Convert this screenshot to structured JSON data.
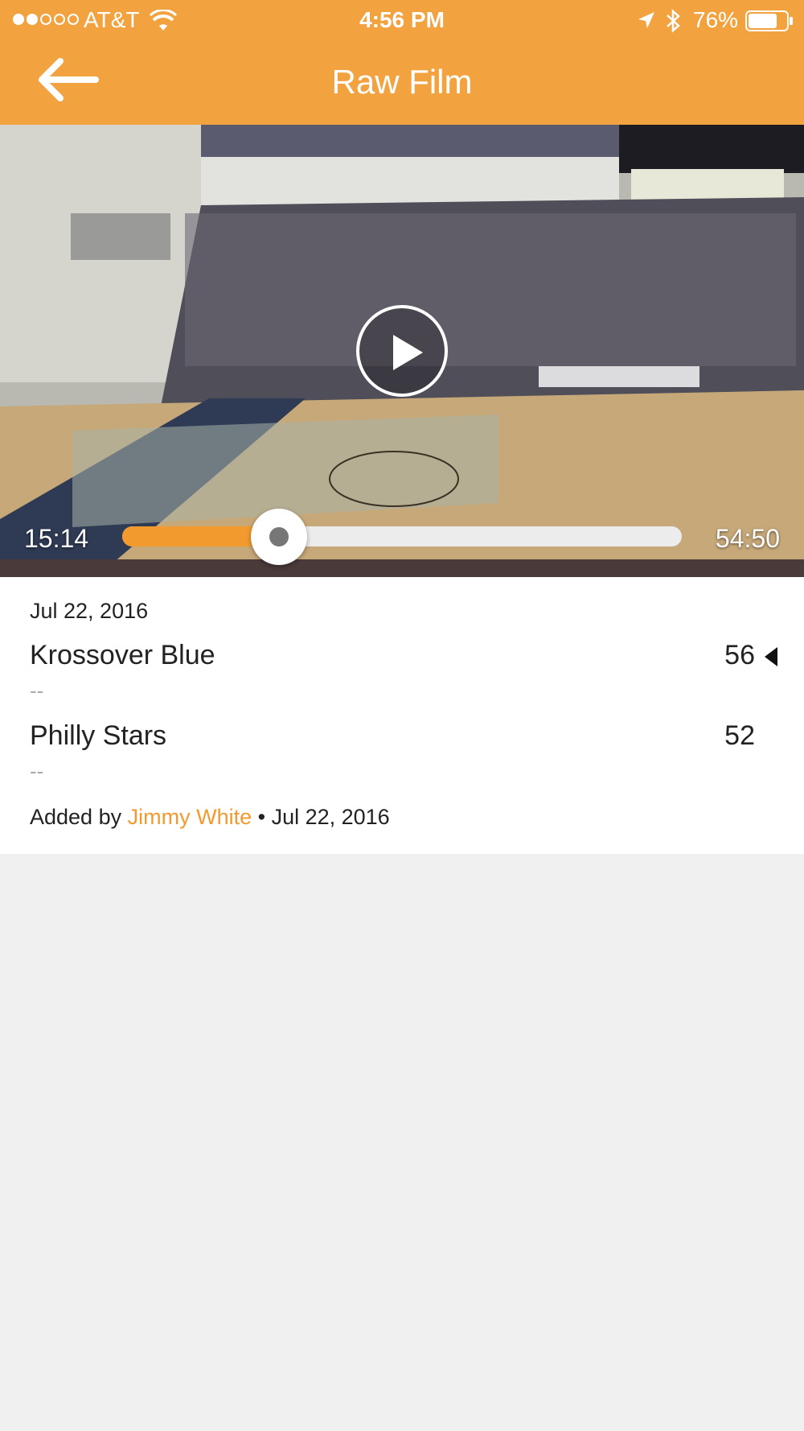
{
  "status_bar": {
    "carrier": "AT&T",
    "time": "4:56 PM",
    "battery": "76%",
    "signal_bars_filled": 2,
    "signal_bars_total": 5,
    "battery_level": 0.76
  },
  "nav": {
    "title": "Raw Film",
    "back_icon": "arrow-left-icon"
  },
  "video": {
    "elapsed": "15:14",
    "duration": "54:50",
    "progress": 0.28,
    "accent_color": "#f29a2e",
    "play_icon": "play-icon"
  },
  "game": {
    "date": "Jul 22, 2016",
    "teams": [
      {
        "name": "Krossover Blue",
        "score": "56",
        "record": "--",
        "winner": true
      },
      {
        "name": "Philly Stars",
        "score": "52",
        "record": "--",
        "winner": false
      }
    ],
    "added_prefix": "Added by",
    "added_by": "Jimmy White",
    "added_date": "• Jul 22, 2016"
  },
  "colors": {
    "header": "#f2a340",
    "link": "#f29a2e",
    "background": "#f0f0f0"
  }
}
